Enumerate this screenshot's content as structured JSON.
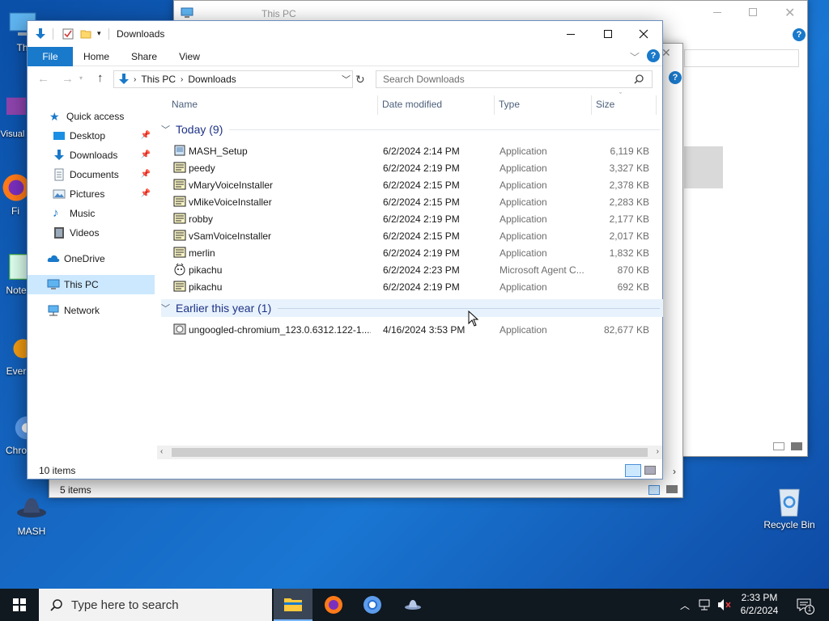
{
  "desktop": {
    "icons": [
      {
        "label": "Th"
      },
      {
        "label": "Visual 2"
      },
      {
        "label": "Fi"
      },
      {
        "label": "Note"
      },
      {
        "label": "Ever"
      },
      {
        "label": "Chro"
      },
      {
        "label": "MASH"
      },
      {
        "label": "Recycle Bin"
      }
    ]
  },
  "background_window": {
    "title": "This PC",
    "status": "5 items"
  },
  "window": {
    "title": "Downloads",
    "ribbon_tabs": [
      "File",
      "Home",
      "Share",
      "View"
    ],
    "breadcrumb": [
      "This PC",
      "Downloads"
    ],
    "search_placeholder": "Search Downloads",
    "status": "10 items"
  },
  "nav": {
    "items": [
      {
        "label": "Quick access"
      },
      {
        "label": "Desktop"
      },
      {
        "label": "Downloads"
      },
      {
        "label": "Documents"
      },
      {
        "label": "Pictures"
      },
      {
        "label": "Music"
      },
      {
        "label": "Videos"
      },
      {
        "label": "OneDrive"
      },
      {
        "label": "This PC"
      },
      {
        "label": "Network"
      }
    ]
  },
  "columns": {
    "name": "Name",
    "date": "Date modified",
    "type": "Type",
    "size": "Size"
  },
  "groups": [
    {
      "title": "Today (9)",
      "files": [
        {
          "name": "MASH_Setup",
          "date": "6/2/2024 2:14 PM",
          "type": "Application",
          "size": "6,119 KB"
        },
        {
          "name": "peedy",
          "date": "6/2/2024 2:19 PM",
          "type": "Application",
          "size": "3,327 KB"
        },
        {
          "name": "vMaryVoiceInstaller",
          "date": "6/2/2024 2:15 PM",
          "type": "Application",
          "size": "2,378 KB"
        },
        {
          "name": "vMikeVoiceInstaller",
          "date": "6/2/2024 2:15 PM",
          "type": "Application",
          "size": "2,283 KB"
        },
        {
          "name": "robby",
          "date": "6/2/2024 2:19 PM",
          "type": "Application",
          "size": "2,177 KB"
        },
        {
          "name": "vSamVoiceInstaller",
          "date": "6/2/2024 2:15 PM",
          "type": "Application",
          "size": "2,017 KB"
        },
        {
          "name": "merlin",
          "date": "6/2/2024 2:19 PM",
          "type": "Application",
          "size": "1,832 KB"
        },
        {
          "name": "pikachu",
          "date": "6/2/2024 2:23 PM",
          "type": "Microsoft Agent C...",
          "size": "870 KB"
        },
        {
          "name": "pikachu",
          "date": "6/2/2024 2:19 PM",
          "type": "Application",
          "size": "692 KB"
        }
      ]
    },
    {
      "title": "Earlier this year (1)",
      "files": [
        {
          "name": "ungoogled-chromium_123.0.6312.122-1....",
          "date": "4/16/2024 3:53 PM",
          "type": "Application",
          "size": "82,677 KB"
        }
      ]
    }
  ],
  "taskbar": {
    "search_placeholder": "Type here to search",
    "time": "2:33 PM",
    "date": "6/2/2024",
    "notification_count": "1"
  },
  "colors": {
    "accent": "#1979ca",
    "selection": "#cce8ff",
    "group_title": "#1e3287",
    "taskbar": "#101820"
  }
}
